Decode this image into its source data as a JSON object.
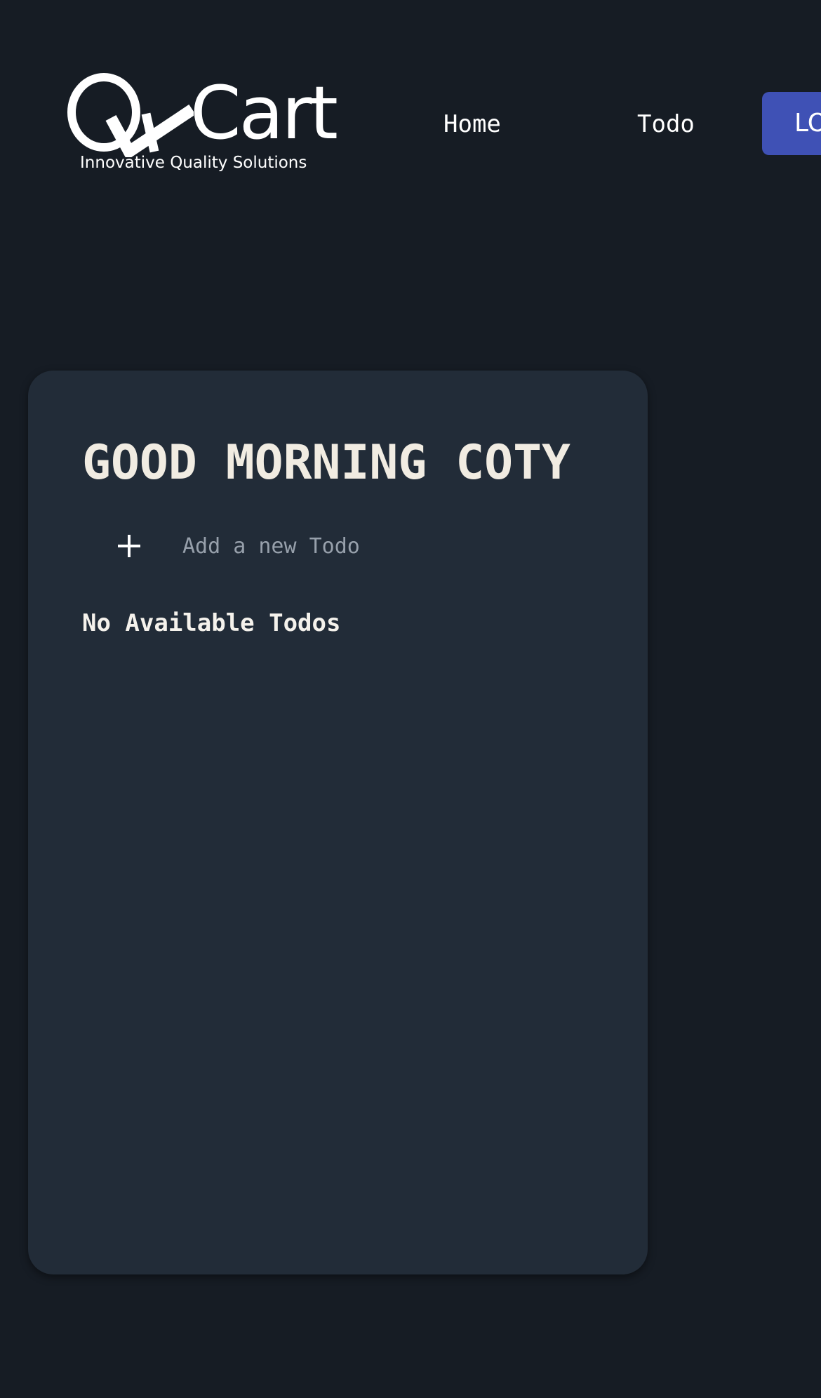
{
  "header": {
    "logo": {
      "brand_text": "Cart",
      "tagline": "Innovative Quality Solutions"
    },
    "nav": {
      "home_label": "Home",
      "todo_label": "Todo"
    },
    "login_label": "LOGOUT"
  },
  "todo_card": {
    "greeting": "GOOD MORNING COTY",
    "add_input": {
      "placeholder": "Add a new Todo",
      "value": ""
    },
    "add_icon": "plus-icon",
    "empty_message": "No Available Todos"
  },
  "colors": {
    "page_background": "#161c24",
    "card_background": "#222c38",
    "accent_button": "#3f51b5",
    "heading_text": "#f1ece2",
    "placeholder_text": "#97a0ab"
  }
}
